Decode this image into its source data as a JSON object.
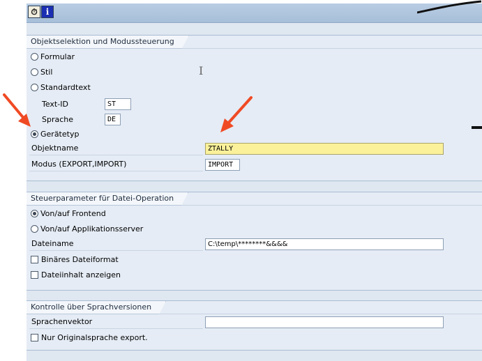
{
  "toolbar": {
    "execute_icon": "execute-clock-icon",
    "info_label": "i"
  },
  "objektselektion": {
    "title": "Objektselektion und Modussteuerung",
    "formular": "Formular",
    "stil": "Stil",
    "standardtext": "Standardtext",
    "textid_label": "Text-ID",
    "textid_value": "ST",
    "sprache_label": "Sprache",
    "sprache_value": "DE",
    "geraetetyp": "Gerätetyp",
    "objektname_label": "Objektname",
    "objektname_value": "ZTALLY",
    "modus_label": "Modus (EXPORT,IMPORT)",
    "modus_value": "IMPORT"
  },
  "steuerparameter": {
    "title": "Steuerparameter für Datei-Operation",
    "frontend": "Von/auf Frontend",
    "server": "Von/auf Applikationsserver",
    "dateiname_label": "Dateiname",
    "dateiname_value": "C:\\temp\\********&&&&",
    "binaer": "Binäres Dateiformat",
    "anzeigen": "Dateiinhalt anzeigen"
  },
  "kontrolle": {
    "title": "Kontrolle über Sprachversionen",
    "sprachenvektor_label": "Sprachenvektor",
    "sprachenvektor_value": "",
    "nur_original": "Nur Originalsprache export."
  },
  "colors": {
    "annotation_arrow": "#f04a24",
    "highlight_field": "#fbf19a"
  }
}
